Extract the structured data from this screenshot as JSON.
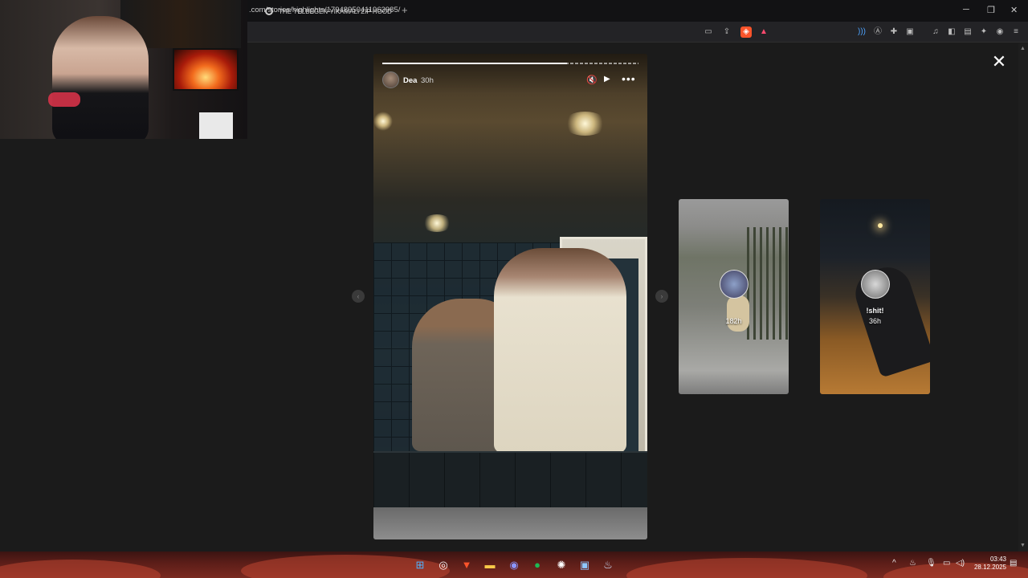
{
  "browser": {
    "tab_title": "THE YELBEGEN YIKAMALI ZIP HOOD",
    "new_tab": "+",
    "url": ".com/stories/highlights/17948950411963985/",
    "window_controls": {
      "minimize": "─",
      "restore": "❐",
      "close": "✕"
    }
  },
  "viewer": {
    "close": "✕",
    "story": {
      "username": "Dea",
      "time": "30h",
      "progress": 0.72,
      "mute_icon": "🔇",
      "play_icon": "▶",
      "more_icon": "•••"
    },
    "nav_prev": "‹",
    "nav_next": "›",
    "previews": [
      {
        "name": "",
        "time": "182h"
      },
      {
        "name": "!shit!",
        "time": "36h"
      }
    ]
  },
  "taskbar": {
    "apps": [
      "windows-start",
      "chrome-dev",
      "brave",
      "file-explorer",
      "discord",
      "spotify",
      "steelseries",
      "window-app",
      "steam"
    ],
    "clock_time": "03:43",
    "clock_date": "28.12.2025"
  },
  "colors": {
    "accent_brave": "#fb542b",
    "spotify": "#1db954",
    "discord": "#5865f2"
  }
}
